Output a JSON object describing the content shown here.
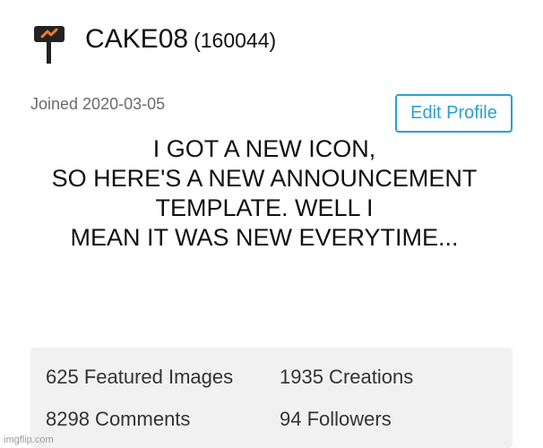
{
  "profile": {
    "username": "CAKE08",
    "points": "(160044)",
    "joined": "Joined 2020-03-05",
    "edit_button": "Edit Profile",
    "avatar_icon": "signpost-logo-icon",
    "accent_color": "#2b9fd6",
    "logo_colors": [
      "#222222",
      "#f07a2a"
    ]
  },
  "announcement": {
    "lines": [
      "I GOT A NEW ICON,",
      "SO HERE'S A NEW ANNOUNCEMENT",
      "TEMPLATE. WELL I",
      "MEAN IT WAS NEW EVERYTIME..."
    ]
  },
  "stats": {
    "featured_images": "625 Featured Images",
    "creations": "1935 Creations",
    "comments": "8298 Comments",
    "followers": "94 Followers"
  },
  "watermark": "imgflip.com"
}
